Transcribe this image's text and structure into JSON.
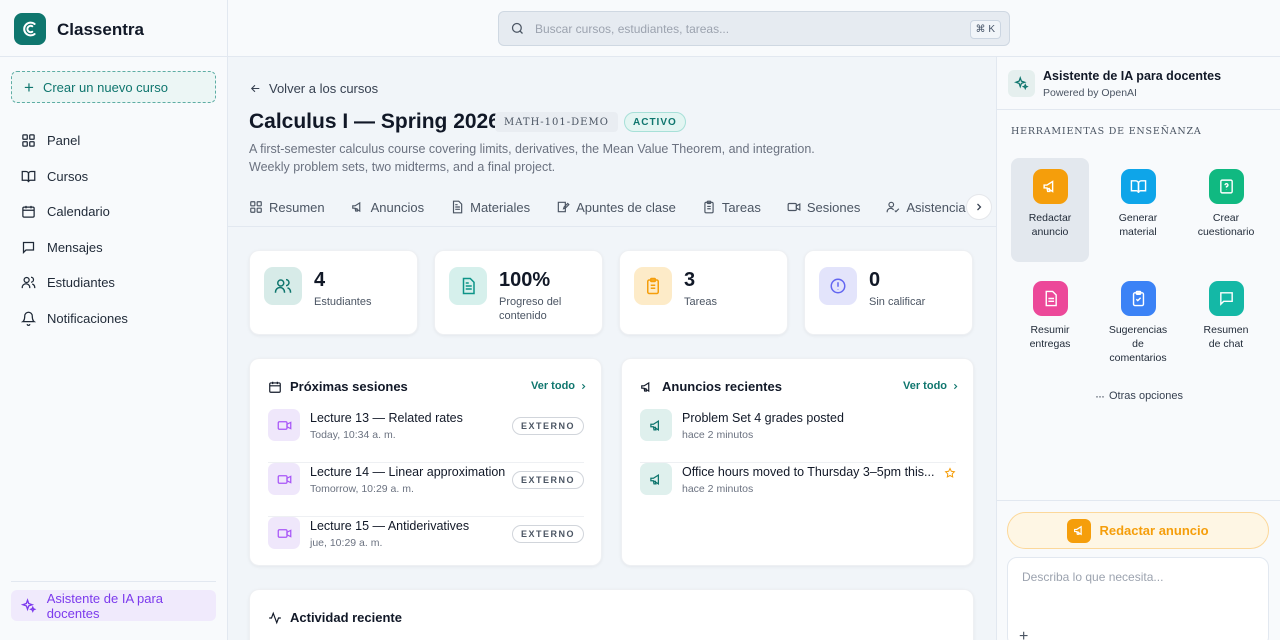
{
  "app": {
    "name": "Classentra"
  },
  "sidebar": {
    "new_course": "Crear un nuevo curso",
    "items": [
      {
        "label": "Panel",
        "icon": "grid-icon"
      },
      {
        "label": "Cursos",
        "icon": "book-icon"
      },
      {
        "label": "Calendario",
        "icon": "calendar-icon"
      },
      {
        "label": "Mensajes",
        "icon": "message-icon"
      },
      {
        "label": "Estudiantes",
        "icon": "users-icon"
      },
      {
        "label": "Notificaciones",
        "icon": "bell-icon"
      }
    ],
    "ai_assistant": "Asistente de IA para docentes"
  },
  "search": {
    "placeholder": "Buscar cursos, estudiantes, tareas...",
    "shortcut": "⌘ K"
  },
  "course": {
    "back": "Volver a los cursos",
    "title": "Calculus I — Spring 2026",
    "code": "MATH-101-DEMO",
    "status": "ACTIVO",
    "description": "A first-semester calculus course covering limits, derivatives, the Mean Value Theorem, and integration. Weekly problem sets, two midterms, and a final project."
  },
  "tabs": [
    {
      "label": "Resumen",
      "icon": "grid-icon"
    },
    {
      "label": "Anuncios",
      "icon": "megaphone-icon"
    },
    {
      "label": "Materiales",
      "icon": "document-icon"
    },
    {
      "label": "Apuntes de clase",
      "icon": "notes-icon"
    },
    {
      "label": "Tareas",
      "icon": "clipboard-icon"
    },
    {
      "label": "Sesiones",
      "icon": "video-icon"
    },
    {
      "label": "Asistencia",
      "icon": "user-check-icon"
    },
    {
      "label": "",
      "icon": "chart-icon"
    }
  ],
  "stats": [
    {
      "value": "4",
      "label": "Estudiantes",
      "icon": "users-icon",
      "color": "#0f766e",
      "bg": "#d7ebe8"
    },
    {
      "value": "100%",
      "label": "Progreso del contenido",
      "icon": "document-icon",
      "color": "#0d9488",
      "bg": "#d6f0ec"
    },
    {
      "value": "3",
      "label": "Tareas",
      "icon": "clipboard-icon",
      "color": "#f59e0b",
      "bg": "#fdebc8"
    },
    {
      "value": "0",
      "label": "Sin calificar",
      "icon": "alert-icon",
      "color": "#6366f1",
      "bg": "#e3e4fb"
    }
  ],
  "sessions": {
    "title": "Próximas sesiones",
    "see_all": "Ver todo",
    "items": [
      {
        "title": "Lecture 13 — Related rates",
        "time": "Today, 10:34 a. m.",
        "badge": "EXTERNO"
      },
      {
        "title": "Lecture 14 — Linear approximation",
        "time": "Tomorrow, 10:29 a. m.",
        "badge": "EXTERNO"
      },
      {
        "title": "Lecture 15 — Antiderivatives",
        "time": "jue, 10:29 a. m.",
        "badge": "EXTERNO"
      }
    ]
  },
  "announcements": {
    "title": "Anuncios recientes",
    "see_all": "Ver todo",
    "items": [
      {
        "title": "Problem Set 4 grades posted",
        "time": "hace 2 minutos"
      },
      {
        "title": "Office hours moved to Thursday 3–5pm this...",
        "time": "hace 2 minutos"
      }
    ]
  },
  "activity": {
    "title": "Actividad reciente"
  },
  "assistant": {
    "title": "Asistente de IA para docentes",
    "subtitle": "Powered by OpenAI",
    "section": "HERRAMIENTAS DE ENSEÑANZA",
    "tools": [
      {
        "label": "Redactar anuncio",
        "icon": "megaphone-icon",
        "color": "#f59e0b"
      },
      {
        "label": "Generar material",
        "icon": "book-open-icon",
        "color": "#0ea5e9"
      },
      {
        "label": "Crear cuestionario",
        "icon": "quiz-icon",
        "color": "#10b981"
      },
      {
        "label": "Resumir entregas",
        "icon": "document-icon",
        "color": "#ec4899"
      },
      {
        "label": "Sugerencias de comentarios",
        "icon": "clipboard-check-icon",
        "color": "#3b82f6"
      },
      {
        "label": "Resumen de chat",
        "icon": "chat-icon",
        "color": "#14b8a6"
      }
    ],
    "more": "Otras opciones",
    "active_tool": "Redactar anuncio",
    "prompt_placeholder": "Describa lo que necesita...",
    "add": "+"
  }
}
